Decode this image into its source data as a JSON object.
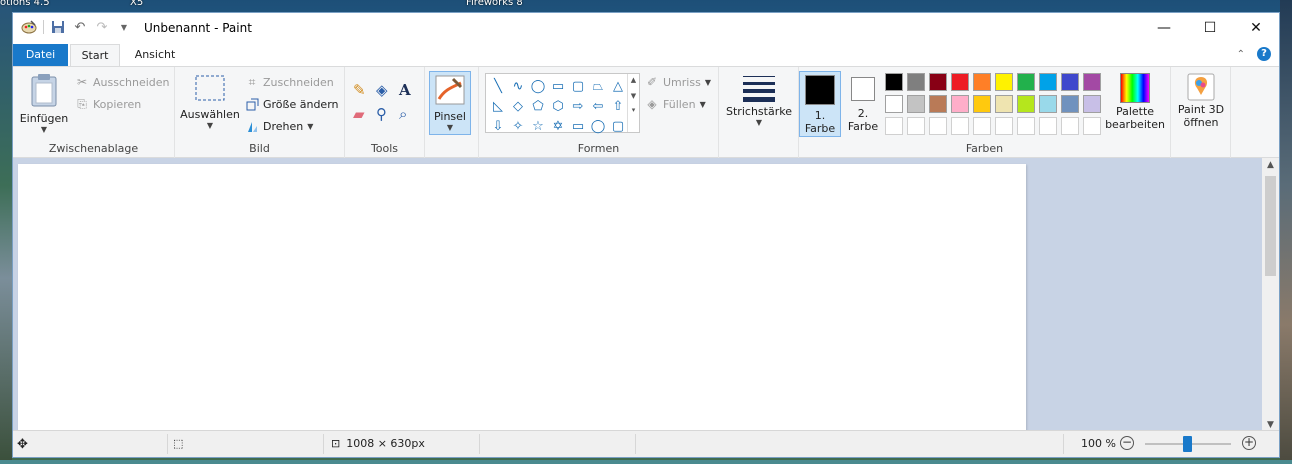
{
  "desktop": {
    "labels": [
      "otions 4.5",
      "X5",
      "Fireworks 8"
    ]
  },
  "window": {
    "title": "Unbenannt - Paint",
    "controls": {
      "minimize": "—",
      "maximize": "☐",
      "close": "✕"
    }
  },
  "tabs": {
    "file": "Datei",
    "home": "Start",
    "view": "Ansicht"
  },
  "clipboard": {
    "group_label": "Zwischenablage",
    "paste": "Einfügen",
    "cut": "Ausschneiden",
    "copy": "Kopieren"
  },
  "image": {
    "group_label": "Bild",
    "select": "Auswählen",
    "crop": "Zuschneiden",
    "resize": "Größe ändern",
    "rotate": "Drehen"
  },
  "tools": {
    "group_label": "Tools",
    "brushes": "Pinsel"
  },
  "shapes": {
    "group_label": "Formen",
    "outline": "Umriss",
    "fill": "Füllen",
    "glyphs": [
      "╲",
      "∿",
      "◯",
      "▭",
      "▢",
      "⏢",
      "△",
      "◺",
      "◇",
      "⬠",
      "⬡",
      "⇨",
      "⇦",
      "⇧",
      "⇩",
      "✧",
      "☆",
      "✡",
      "▭",
      "◯",
      "▢"
    ]
  },
  "size": {
    "label": "Strichstärke"
  },
  "colors": {
    "group_label": "Farben",
    "color1_line1": "1.",
    "color1_line2": "Farbe",
    "color2_line1": "2.",
    "color2_line2": "Farbe",
    "color1": "#000000",
    "color2": "#ffffff",
    "palette_row1": [
      "#000000",
      "#7f7f7f",
      "#880015",
      "#ed1c24",
      "#ff7f27",
      "#fff200",
      "#22b14c",
      "#00a2e8",
      "#3f48cc",
      "#a349a4"
    ],
    "palette_row2": [
      "#ffffff",
      "#c3c3c3",
      "#b97a57",
      "#ffaec9",
      "#ffc90e",
      "#efe4b0",
      "#b5e61d",
      "#99d9ea",
      "#7092be",
      "#c8bfe7"
    ],
    "edit_line1": "Palette",
    "edit_line2": "bearbeiten"
  },
  "paint3d": {
    "line1": "Paint 3D",
    "line2": "öffnen"
  },
  "status": {
    "dimensions": "1008 × 630px",
    "zoom": "100 %"
  }
}
